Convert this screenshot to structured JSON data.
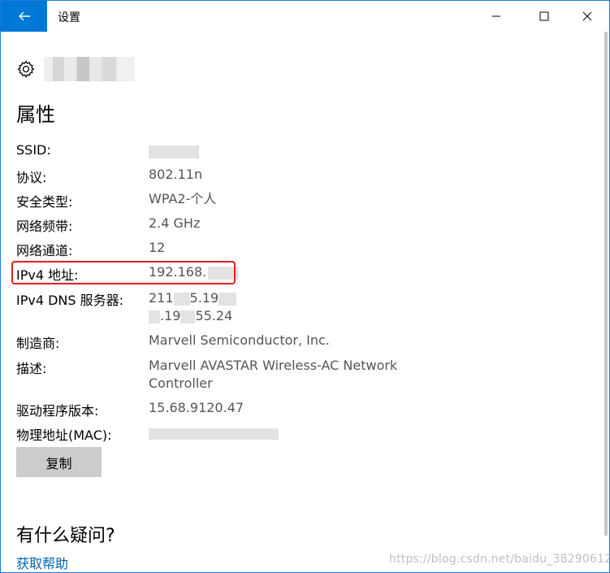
{
  "window": {
    "title": "设置",
    "back_icon": "arrow-left-icon",
    "accent": "#0078d7"
  },
  "header": {
    "icon": "gear-icon"
  },
  "section_title": "属性",
  "properties": {
    "ssid": {
      "label": "SSID:",
      "value": ""
    },
    "protocol": {
      "label": "协议:",
      "value": "802.11n"
    },
    "security_type": {
      "label": "安全类型:",
      "value": "WPA2-个人"
    },
    "band": {
      "label": "网络频带:",
      "value": "2.4 GHz"
    },
    "channel": {
      "label": "网络通道:",
      "value": "12"
    },
    "ipv4": {
      "label": "IPv4 地址:",
      "value": "192.168."
    },
    "dns": {
      "label": "IPv4 DNS 服务器:",
      "value_line1_a": "211",
      "value_line1_b": "5.19",
      "value_line2_a": ".19",
      "value_line2_b": "55.24"
    },
    "manufacturer": {
      "label": "制造商:",
      "value": "Marvell Semiconductor, Inc."
    },
    "description": {
      "label": "描述:",
      "value_line1": "Marvell AVASTAR Wireless-AC Network",
      "value_line2": "Controller"
    },
    "driver_version": {
      "label": "驱动程序版本:",
      "value": "15.68.9120.47"
    },
    "mac": {
      "label": "物理地址(MAC):",
      "value": ""
    }
  },
  "copy_button": {
    "label": "复制"
  },
  "help": {
    "question": "有什么疑问?",
    "link": "获取帮助"
  },
  "watermark": "https://blog.csdn.net/baidu_38290612",
  "highlight_color": "#e0201f"
}
